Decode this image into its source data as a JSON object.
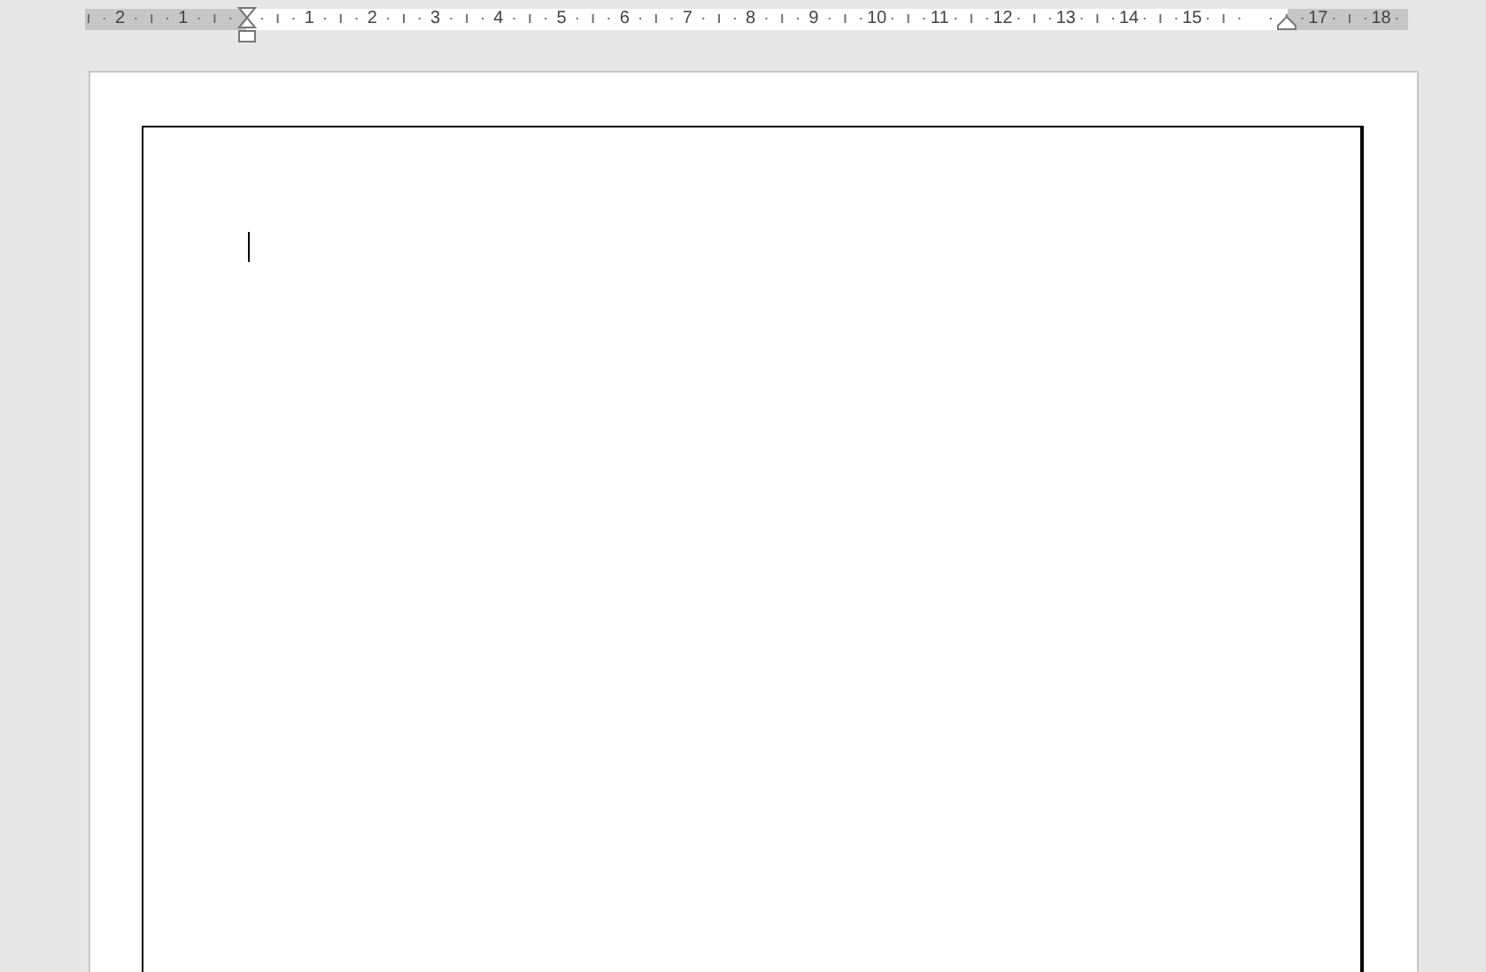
{
  "ruler": {
    "left_margin_labels": [
      "2",
      "1"
    ],
    "text_labels": [
      "1",
      "2",
      "3",
      "4",
      "5",
      "6",
      "7",
      "8",
      "9",
      "10",
      "11",
      "12",
      "13",
      "14",
      "15"
    ],
    "right_margin_labels": [
      "17",
      "18"
    ]
  },
  "page": {
    "page_border": true,
    "text_cursor": true
  }
}
